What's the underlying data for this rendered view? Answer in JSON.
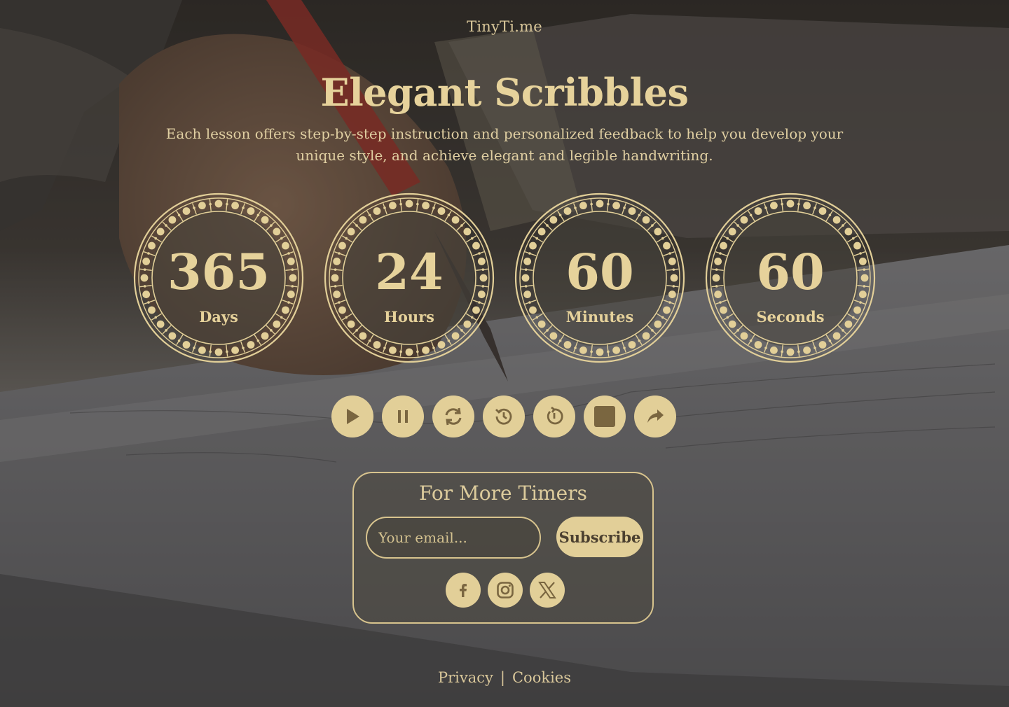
{
  "site": {
    "name": "TinyTi.me"
  },
  "hero": {
    "title": "Elegant Scribbles",
    "subtitle": "Each lesson offers step-by-step instruction and personalized feedback to help you develop your unique style, and achieve elegant and legible handwriting."
  },
  "timers": [
    {
      "value": "365",
      "label": "Days"
    },
    {
      "value": "24",
      "label": "Hours"
    },
    {
      "value": "60",
      "label": "Minutes"
    },
    {
      "value": "60",
      "label": "Seconds"
    }
  ],
  "controls": [
    {
      "name": "play-button",
      "icon": "play-icon"
    },
    {
      "name": "pause-button",
      "icon": "pause-icon"
    },
    {
      "name": "refresh-button",
      "icon": "refresh-icon"
    },
    {
      "name": "history-button",
      "icon": "history-icon"
    },
    {
      "name": "restart-button",
      "icon": "restart-icon"
    },
    {
      "name": "stop-button",
      "icon": "stop-icon"
    },
    {
      "name": "share-button",
      "icon": "share-icon"
    }
  ],
  "subscribe": {
    "title": "For More Timers",
    "email_placeholder": "Your email...",
    "button_label": "Subscribe",
    "social": [
      "facebook-icon",
      "instagram-icon",
      "x-icon"
    ]
  },
  "footer": {
    "privacy": "Privacy",
    "separator": "|",
    "cookies": "Cookies"
  },
  "colors": {
    "accent": "#e2cf98",
    "text_light": "#d9c79a",
    "icon_dark": "#7a6640"
  }
}
